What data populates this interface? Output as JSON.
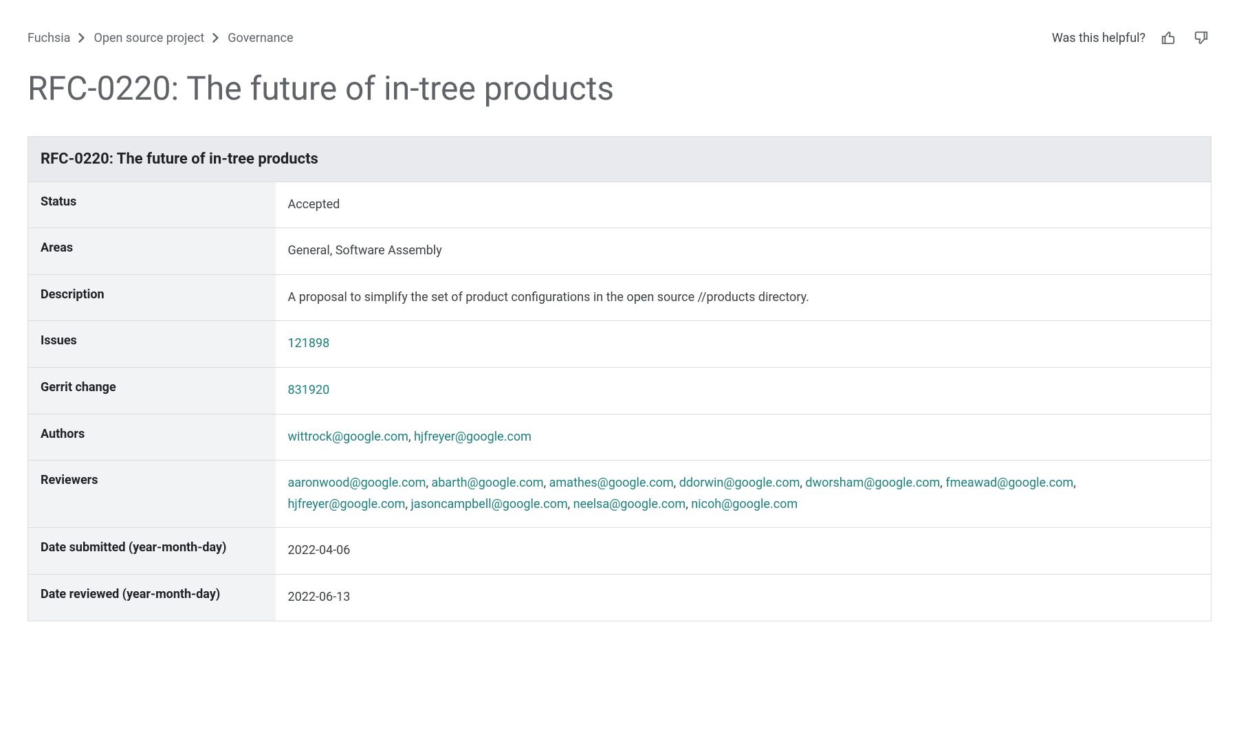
{
  "breadcrumb": {
    "items": [
      "Fuchsia",
      "Open source project",
      "Governance"
    ]
  },
  "feedback": {
    "prompt": "Was this helpful?"
  },
  "title": "RFC-0220: The future of in-tree products",
  "table": {
    "header": "RFC-0220: The future of in-tree products",
    "rows": {
      "status": {
        "label": "Status",
        "value": "Accepted"
      },
      "areas": {
        "label": "Areas",
        "value": "General, Software Assembly"
      },
      "description": {
        "label": "Description",
        "value": "A proposal to simplify the set of product configurations in the open source //products directory."
      },
      "issues": {
        "label": "Issues",
        "links": [
          "121898"
        ]
      },
      "gerrit": {
        "label": "Gerrit change",
        "links": [
          "831920"
        ]
      },
      "authors": {
        "label": "Authors",
        "links": [
          "wittrock@google.com",
          "hjfreyer@google.com"
        ]
      },
      "reviewers": {
        "label": "Reviewers",
        "links": [
          "aaronwood@google.com",
          "abarth@google.com",
          "amathes@google.com",
          "ddorwin@google.com",
          "dworsham@google.com",
          "fmeawad@google.com",
          "hjfreyer@google.com",
          "jasoncampbell@google.com",
          "neelsa@google.com",
          "nicoh@google.com"
        ]
      },
      "date_submitted": {
        "label": "Date submitted (year-month-day)",
        "value": "2022-04-06"
      },
      "date_reviewed": {
        "label": "Date reviewed (year-month-day)",
        "value": "2022-06-13"
      }
    }
  }
}
